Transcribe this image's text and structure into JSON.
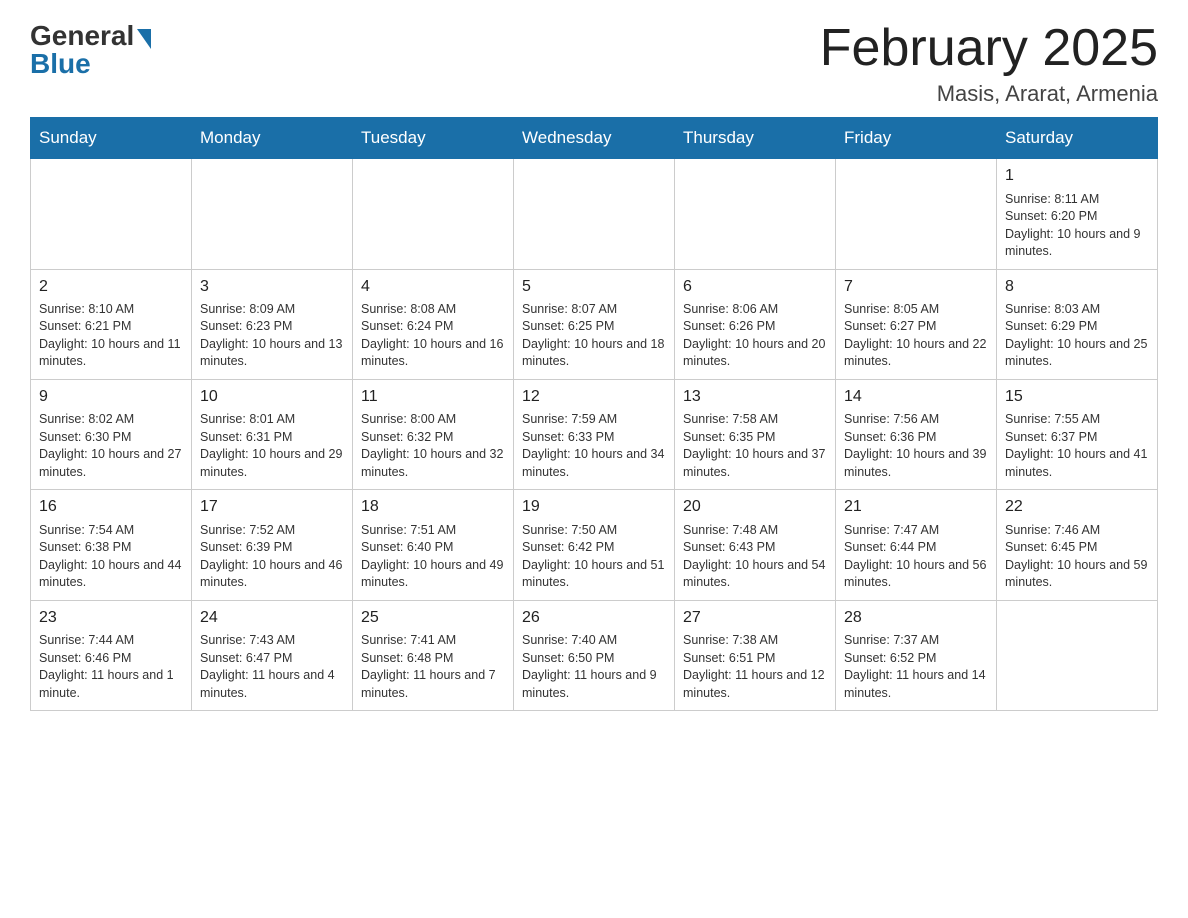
{
  "header": {
    "logo_general": "General",
    "logo_blue": "Blue",
    "title": "February 2025",
    "location": "Masis, Ararat, Armenia"
  },
  "weekdays": [
    "Sunday",
    "Monday",
    "Tuesday",
    "Wednesday",
    "Thursday",
    "Friday",
    "Saturday"
  ],
  "weeks": [
    [
      {
        "num": "",
        "info": ""
      },
      {
        "num": "",
        "info": ""
      },
      {
        "num": "",
        "info": ""
      },
      {
        "num": "",
        "info": ""
      },
      {
        "num": "",
        "info": ""
      },
      {
        "num": "",
        "info": ""
      },
      {
        "num": "1",
        "info": "Sunrise: 8:11 AM\nSunset: 6:20 PM\nDaylight: 10 hours and 9 minutes."
      }
    ],
    [
      {
        "num": "2",
        "info": "Sunrise: 8:10 AM\nSunset: 6:21 PM\nDaylight: 10 hours and 11 minutes."
      },
      {
        "num": "3",
        "info": "Sunrise: 8:09 AM\nSunset: 6:23 PM\nDaylight: 10 hours and 13 minutes."
      },
      {
        "num": "4",
        "info": "Sunrise: 8:08 AM\nSunset: 6:24 PM\nDaylight: 10 hours and 16 minutes."
      },
      {
        "num": "5",
        "info": "Sunrise: 8:07 AM\nSunset: 6:25 PM\nDaylight: 10 hours and 18 minutes."
      },
      {
        "num": "6",
        "info": "Sunrise: 8:06 AM\nSunset: 6:26 PM\nDaylight: 10 hours and 20 minutes."
      },
      {
        "num": "7",
        "info": "Sunrise: 8:05 AM\nSunset: 6:27 PM\nDaylight: 10 hours and 22 minutes."
      },
      {
        "num": "8",
        "info": "Sunrise: 8:03 AM\nSunset: 6:29 PM\nDaylight: 10 hours and 25 minutes."
      }
    ],
    [
      {
        "num": "9",
        "info": "Sunrise: 8:02 AM\nSunset: 6:30 PM\nDaylight: 10 hours and 27 minutes."
      },
      {
        "num": "10",
        "info": "Sunrise: 8:01 AM\nSunset: 6:31 PM\nDaylight: 10 hours and 29 minutes."
      },
      {
        "num": "11",
        "info": "Sunrise: 8:00 AM\nSunset: 6:32 PM\nDaylight: 10 hours and 32 minutes."
      },
      {
        "num": "12",
        "info": "Sunrise: 7:59 AM\nSunset: 6:33 PM\nDaylight: 10 hours and 34 minutes."
      },
      {
        "num": "13",
        "info": "Sunrise: 7:58 AM\nSunset: 6:35 PM\nDaylight: 10 hours and 37 minutes."
      },
      {
        "num": "14",
        "info": "Sunrise: 7:56 AM\nSunset: 6:36 PM\nDaylight: 10 hours and 39 minutes."
      },
      {
        "num": "15",
        "info": "Sunrise: 7:55 AM\nSunset: 6:37 PM\nDaylight: 10 hours and 41 minutes."
      }
    ],
    [
      {
        "num": "16",
        "info": "Sunrise: 7:54 AM\nSunset: 6:38 PM\nDaylight: 10 hours and 44 minutes."
      },
      {
        "num": "17",
        "info": "Sunrise: 7:52 AM\nSunset: 6:39 PM\nDaylight: 10 hours and 46 minutes."
      },
      {
        "num": "18",
        "info": "Sunrise: 7:51 AM\nSunset: 6:40 PM\nDaylight: 10 hours and 49 minutes."
      },
      {
        "num": "19",
        "info": "Sunrise: 7:50 AM\nSunset: 6:42 PM\nDaylight: 10 hours and 51 minutes."
      },
      {
        "num": "20",
        "info": "Sunrise: 7:48 AM\nSunset: 6:43 PM\nDaylight: 10 hours and 54 minutes."
      },
      {
        "num": "21",
        "info": "Sunrise: 7:47 AM\nSunset: 6:44 PM\nDaylight: 10 hours and 56 minutes."
      },
      {
        "num": "22",
        "info": "Sunrise: 7:46 AM\nSunset: 6:45 PM\nDaylight: 10 hours and 59 minutes."
      }
    ],
    [
      {
        "num": "23",
        "info": "Sunrise: 7:44 AM\nSunset: 6:46 PM\nDaylight: 11 hours and 1 minute."
      },
      {
        "num": "24",
        "info": "Sunrise: 7:43 AM\nSunset: 6:47 PM\nDaylight: 11 hours and 4 minutes."
      },
      {
        "num": "25",
        "info": "Sunrise: 7:41 AM\nSunset: 6:48 PM\nDaylight: 11 hours and 7 minutes."
      },
      {
        "num": "26",
        "info": "Sunrise: 7:40 AM\nSunset: 6:50 PM\nDaylight: 11 hours and 9 minutes."
      },
      {
        "num": "27",
        "info": "Sunrise: 7:38 AM\nSunset: 6:51 PM\nDaylight: 11 hours and 12 minutes."
      },
      {
        "num": "28",
        "info": "Sunrise: 7:37 AM\nSunset: 6:52 PM\nDaylight: 11 hours and 14 minutes."
      },
      {
        "num": "",
        "info": ""
      }
    ]
  ]
}
